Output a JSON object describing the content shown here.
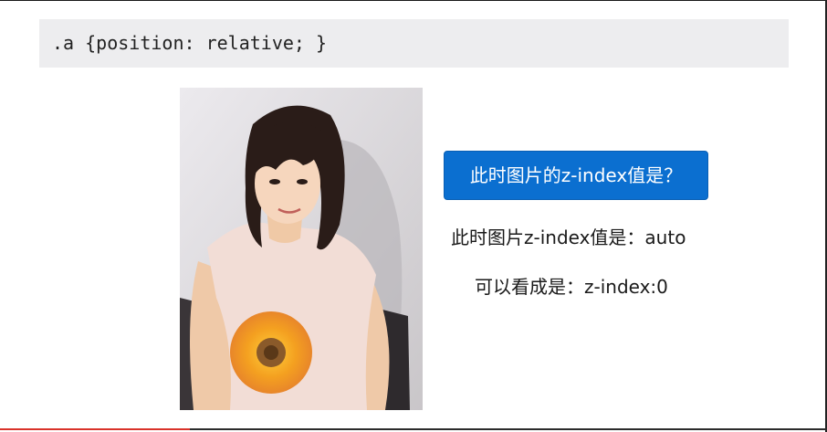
{
  "code": {
    "line": ".a {position: relative; }"
  },
  "photo": {
    "icon": "person-photo"
  },
  "quiz": {
    "question": "此时图片的z-index值是？",
    "answer": "此时图片z-index值是：auto",
    "explanation": "可以看成是：z-index:0"
  },
  "colors": {
    "accent": "#0b6fd0",
    "progress": "#d9322a"
  },
  "progress": {
    "fraction": 0.23
  }
}
